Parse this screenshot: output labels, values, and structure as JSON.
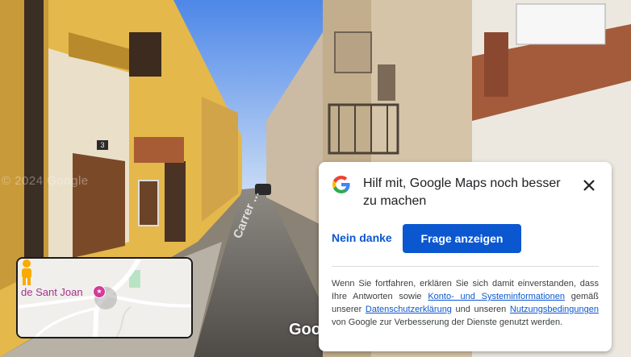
{
  "streetview": {
    "watermark": "© 2024 Google",
    "street_name": "Carrer ...",
    "house_number": "3",
    "google_logo": "Google"
  },
  "minimap": {
    "place_label": "de Sant Joan",
    "poi_icon": "tourist-attraction-icon",
    "pegman_icon": "pegman-icon"
  },
  "dialog": {
    "title": "Hilf mit, Google Maps noch besser zu machen",
    "close_icon": "close-icon",
    "decline_label": "Nein danke",
    "show_question_label": "Frage anzeigen",
    "disclaimer": {
      "part1": "Wenn Sie fortfahren, erklären Sie sich damit einverstanden, dass Ihre Antworten sowie ",
      "link1": "Konto- und Systeminformationen",
      "part2": " gemäß unserer ",
      "link2": "Datenschutzerklärung",
      "part3": " und unseren ",
      "link3": "Nutzungsbedingungen",
      "part4": " von Google zur Verbesserung der Dienste genutzt werden."
    }
  },
  "colors": {
    "primary_blue": "#0b57d0",
    "poi_pink": "#d23b9a"
  }
}
